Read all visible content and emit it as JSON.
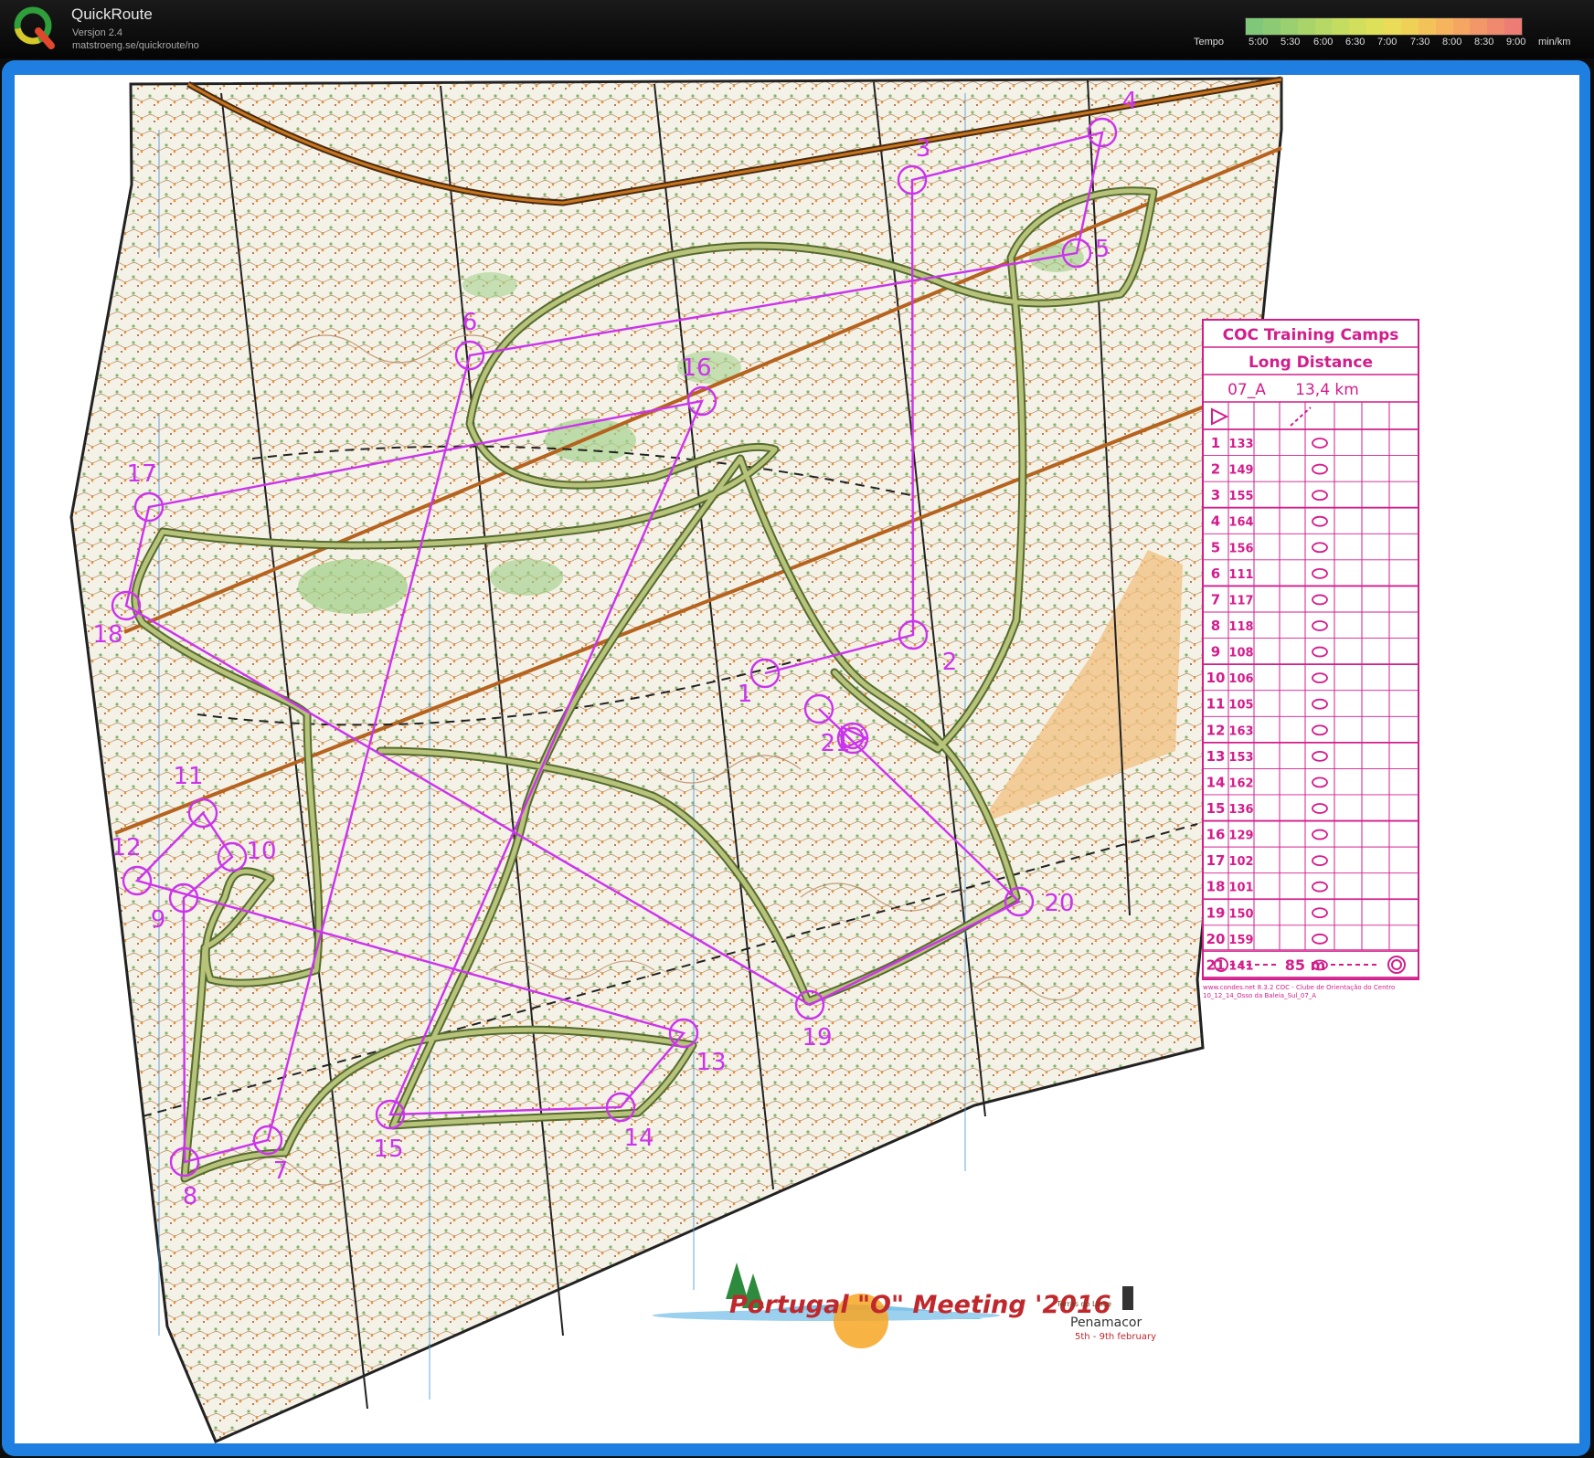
{
  "app": {
    "title": "QuickRoute",
    "version": "Versjon 2.4",
    "url": "matstroeng.se/quickroute/no"
  },
  "tempo_legend": {
    "label": "Tempo",
    "ticks": [
      "5:00",
      "5:30",
      "6:00",
      "6:30",
      "7:00",
      "7:30",
      "8:00",
      "8:30",
      "9:00",
      "min/km"
    ],
    "gradient_colors": [
      "#7fc779",
      "#8ccb74",
      "#9ad06f",
      "#a8d46a",
      "#b6d865",
      "#c4dc60",
      "#d2df5d",
      "#dfe05a",
      "#eadc59",
      "#f0d158",
      "#f3c35a",
      "#f5b45d",
      "#f4a662",
      "#f29868",
      "#ef8a6e",
      "#ec7c74"
    ]
  },
  "colors": {
    "frame": "#1e7fe0",
    "course": "#cc33ee",
    "route_outer": "#556b2f",
    "route_inner": "#b7c27a",
    "map_bg": "#f4f1e6",
    "magenta_text": "#d21e8c"
  },
  "controls": [
    {
      "label": "1"
    },
    {
      "label": "2"
    },
    {
      "label": "3"
    },
    {
      "label": "4"
    },
    {
      "label": "5"
    },
    {
      "label": "6"
    },
    {
      "label": "7"
    },
    {
      "label": "8"
    },
    {
      "label": "9"
    },
    {
      "label": "10"
    },
    {
      "label": "11"
    },
    {
      "label": "12"
    },
    {
      "label": "13"
    },
    {
      "label": "14"
    },
    {
      "label": "15"
    },
    {
      "label": "16"
    },
    {
      "label": "17"
    },
    {
      "label": "18"
    },
    {
      "label": "19"
    },
    {
      "label": "20"
    },
    {
      "label": "21"
    }
  ],
  "description_sheet": {
    "title": "COC Training Camps",
    "subtitle": "Long Distance",
    "course": "07_A",
    "length": "13,4 km",
    "rows": [
      {
        "num": "1",
        "code": "133"
      },
      {
        "num": "2",
        "code": "149"
      },
      {
        "num": "3",
        "code": "155"
      },
      {
        "num": "4",
        "code": "164"
      },
      {
        "num": "5",
        "code": "156"
      },
      {
        "num": "6",
        "code": "111"
      },
      {
        "num": "7",
        "code": "117"
      },
      {
        "num": "8",
        "code": "118"
      },
      {
        "num": "9",
        "code": "108"
      },
      {
        "num": "10",
        "code": "106"
      },
      {
        "num": "11",
        "code": "105"
      },
      {
        "num": "12",
        "code": "163"
      },
      {
        "num": "13",
        "code": "153"
      },
      {
        "num": "14",
        "code": "162"
      },
      {
        "num": "15",
        "code": "136"
      },
      {
        "num": "16",
        "code": "129"
      },
      {
        "num": "17",
        "code": "102"
      },
      {
        "num": "18",
        "code": "101"
      },
      {
        "num": "19",
        "code": "150"
      },
      {
        "num": "20",
        "code": "159"
      },
      {
        "num": "21",
        "code": "141"
      }
    ],
    "finish_distance": "85 m",
    "footer_line1": "www.condes.net 8.3.2  COC - Clube de Orientação do Centro",
    "footer_line2": "10_12_14_Osso da Baleia_Sul_07_A"
  },
  "event_logo": {
    "title": "Portugal \"O\" Meeting '2016",
    "town": "Penamacor",
    "dates": "5th - 9th february",
    "badge": "Terras do Lince"
  }
}
